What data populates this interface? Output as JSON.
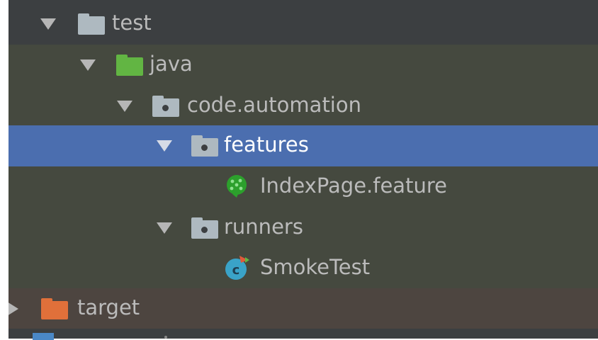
{
  "tree": {
    "items": [
      {
        "label": "test",
        "expanded": true,
        "icon": "test-folder-icon"
      },
      {
        "label": "java",
        "expanded": true,
        "icon": "source-folder-icon"
      },
      {
        "label": "code.automation",
        "expanded": true,
        "icon": "package-folder-icon"
      },
      {
        "label": "features",
        "expanded": true,
        "selected": true,
        "icon": "package-folder-icon"
      },
      {
        "label": "IndexPage.feature",
        "icon": "cucumber-icon"
      },
      {
        "label": "runners",
        "expanded": true,
        "icon": "package-folder-icon"
      },
      {
        "label": "SmokeTest",
        "icon": "class-icon"
      },
      {
        "label": "target",
        "expanded": false,
        "icon": "excluded-folder-icon"
      }
    ]
  },
  "colors": {
    "background": "#3c3f41",
    "selection": "#4b6eaf",
    "source_row": "#45493f",
    "excluded_row": "#4d4540",
    "text": "#bbbbbb",
    "folder_gray": "#aeb9c0",
    "folder_green": "#62b543",
    "folder_orange": "#e0703a"
  }
}
